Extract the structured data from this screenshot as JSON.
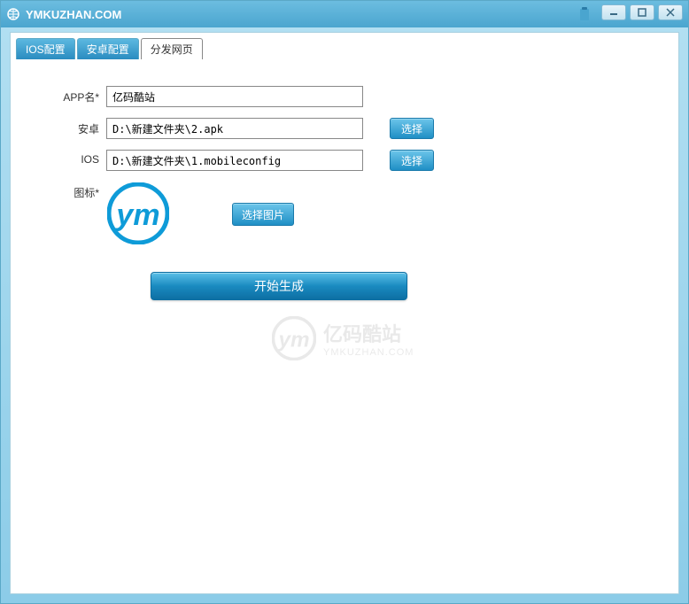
{
  "window": {
    "title": "YMKUZHAN.COM"
  },
  "tabs": [
    {
      "label": "IOS配置",
      "active": false
    },
    {
      "label": "安卓配置",
      "active": false
    },
    {
      "label": "分发网页",
      "active": true
    }
  ],
  "form": {
    "appname_label": "APP名*",
    "appname_value": "亿码酷站",
    "android_label": "安卓",
    "android_value": "D:\\新建文件夹\\2.apk",
    "android_browse": "选择",
    "ios_label": "IOS",
    "ios_value": "D:\\新建文件夹\\1.mobileconfig",
    "ios_browse": "选择",
    "icon_label": "图标*",
    "pick_image": "选择图片",
    "generate": "开始生成"
  },
  "watermark": {
    "cn": "亿码酷站",
    "en": "YMKUZHAN.COM"
  }
}
